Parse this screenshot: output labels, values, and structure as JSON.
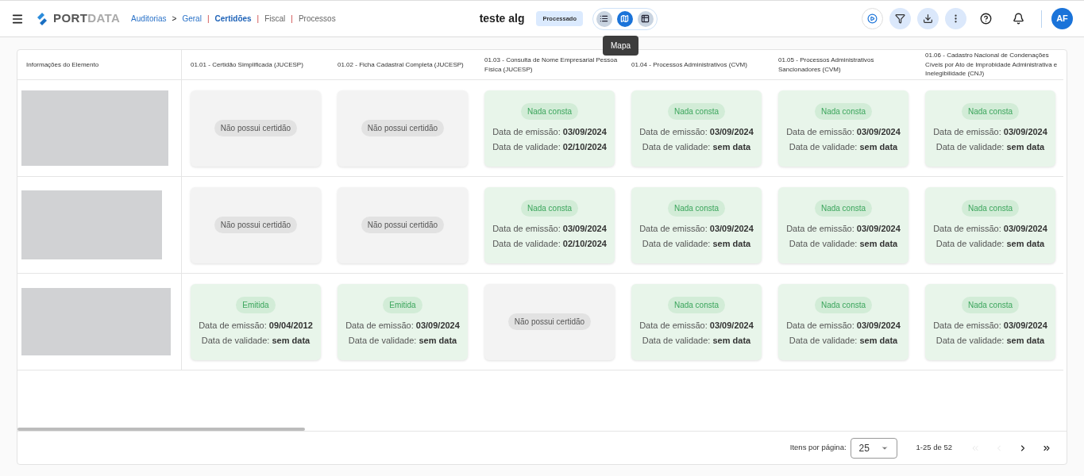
{
  "header": {
    "logo": {
      "strong": "PORT",
      "light": "DATA"
    },
    "breadcrumb": [
      {
        "label": "Auditorias",
        "kind": "link",
        "selected": false,
        "separator": ">"
      },
      {
        "label": "Geral",
        "kind": "link",
        "selected": false,
        "separator": "|"
      },
      {
        "label": "Certidões",
        "kind": "tab",
        "selected": true,
        "separator": "|"
      },
      {
        "label": "Fiscal",
        "kind": "tab",
        "selected": false,
        "separator": "|"
      },
      {
        "label": "Processos",
        "kind": "tab",
        "selected": false
      }
    ],
    "title": "teste alg",
    "status": "Processado",
    "views": [
      {
        "kind": "list",
        "selected": false
      },
      {
        "kind": "map",
        "selected": true
      },
      {
        "kind": "table",
        "selected": false
      }
    ],
    "tooltip": "Mapa",
    "actions": [
      {
        "kind": "play"
      },
      {
        "kind": "filter"
      },
      {
        "kind": "download"
      },
      {
        "kind": "more"
      },
      {
        "kind": "help"
      },
      {
        "kind": "bell"
      }
    ],
    "avatar": "AF"
  },
  "table": {
    "columns": [
      "Informações do Elemento",
      "01.01 - Certidão Simplificada (JUCESP)",
      "01.02 - Ficha Cadastral Completa (JUCESP)",
      "01.03 - Consulta de Nome Empresarial Pessoa Física (JUCESP)",
      "01.04 - Processos Administrativos (CVM)",
      "01.05 - Processos Administrativos Sancionadores (CVM)",
      "01.06 - Cadastro Nacional de Condenações Cíveis por Ato de Improbidade Administrativa e Inelegibilidade (CNJ)"
    ],
    "rows": [
      {
        "cells": [
          {
            "kind": "picture"
          },
          {
            "kind": "none",
            "label": "Não possui certidão"
          },
          {
            "kind": "none",
            "label": "Não possui certidão"
          },
          {
            "kind": "status",
            "badge": "Nada consta",
            "emission_label": "Data de emissão:",
            "emission": "03/09/2024",
            "validity_label": "Data de validade:",
            "validity": "02/10/2024"
          },
          {
            "kind": "status",
            "badge": "Nada consta",
            "emission_label": "Data de emissão:",
            "emission": "03/09/2024",
            "validity_label": "Data de validade:",
            "validity": "sem data"
          },
          {
            "kind": "status",
            "badge": "Nada consta",
            "emission_label": "Data de emissão:",
            "emission": "03/09/2024",
            "validity_label": "Data de validade:",
            "validity": "sem data"
          },
          {
            "kind": "status",
            "badge": "Nada consta",
            "emission_label": "Data de emissão:",
            "emission": "03/09/2024",
            "validity_label": "Data de validade:",
            "validity": "sem data"
          }
        ]
      },
      {
        "cells": [
          {
            "kind": "picture"
          },
          {
            "kind": "none",
            "label": "Não possui certidão"
          },
          {
            "kind": "none",
            "label": "Não possui certidão"
          },
          {
            "kind": "status",
            "badge": "Nada consta",
            "emission_label": "Data de emissão:",
            "emission": "03/09/2024",
            "validity_label": "Data de validade:",
            "validity": "02/10/2024"
          },
          {
            "kind": "status",
            "badge": "Nada consta",
            "emission_label": "Data de emissão:",
            "emission": "03/09/2024",
            "validity_label": "Data de validade:",
            "validity": "sem data"
          },
          {
            "kind": "status",
            "badge": "Nada consta",
            "emission_label": "Data de emissão:",
            "emission": "03/09/2024",
            "validity_label": "Data de validade:",
            "validity": "sem data"
          },
          {
            "kind": "status",
            "badge": "Nada consta",
            "emission_label": "Data de emissão:",
            "emission": "03/09/2024",
            "validity_label": "Data de validade:",
            "validity": "sem data"
          }
        ]
      },
      {
        "cells": [
          {
            "kind": "picture"
          },
          {
            "kind": "status",
            "badge": "Emitida",
            "emission_label": "Data de emissão:",
            "emission": "09/04/2012",
            "validity_label": "Data de validade:",
            "validity": "sem data"
          },
          {
            "kind": "status",
            "badge": "Emitida",
            "emission_label": "Data de emissão:",
            "emission": "03/09/2024",
            "validity_label": "Data de validade:",
            "validity": "sem data"
          },
          {
            "kind": "none",
            "label": "Não possui certidão"
          },
          {
            "kind": "status",
            "badge": "Nada consta",
            "emission_label": "Data de emissão:",
            "emission": "03/09/2024",
            "validity_label": "Data de validade:",
            "validity": "sem data"
          },
          {
            "kind": "status",
            "badge": "Nada consta",
            "emission_label": "Data de emissão:",
            "emission": "03/09/2024",
            "validity_label": "Data de validade:",
            "validity": "sem data"
          },
          {
            "kind": "status",
            "badge": "Nada consta",
            "emission_label": "Data de emissão:",
            "emission": "03/09/2024",
            "validity_label": "Data de validade:",
            "validity": "sem data"
          }
        ]
      }
    ]
  },
  "paginator": {
    "label": "Itens por página:",
    "page_size": "25",
    "range": "1-25 de 52",
    "buttons": [
      {
        "kind": "first",
        "disabled": true
      },
      {
        "kind": "prev",
        "disabled": true
      },
      {
        "kind": "next",
        "disabled": false
      },
      {
        "kind": "last",
        "disabled": false
      }
    ]
  }
}
